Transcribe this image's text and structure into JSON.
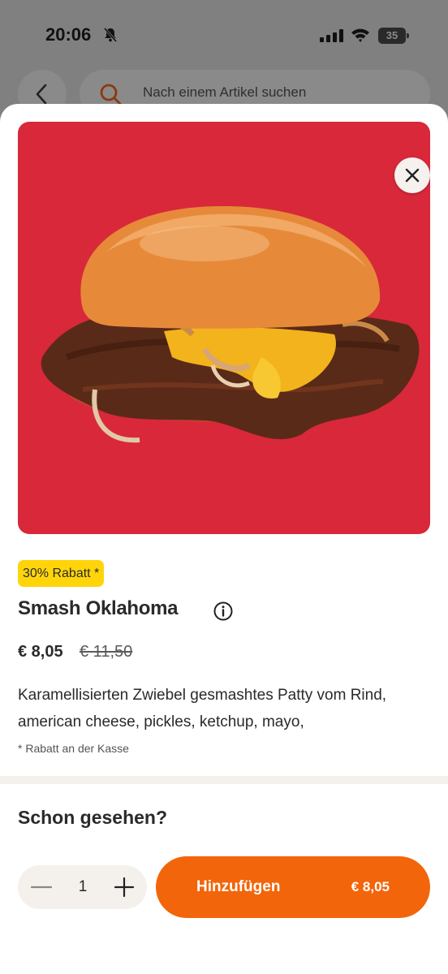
{
  "status_bar": {
    "time": "20:06",
    "battery": "35",
    "icons": [
      "bell-muted-icon",
      "signal-icon",
      "wifi-icon",
      "battery-icon"
    ]
  },
  "background": {
    "search": {
      "placeholder": "Nach einem Artikel suchen"
    }
  },
  "product": {
    "badge": "30% Rabatt *",
    "name": "Smash Oklahoma",
    "price": "€ 8,05",
    "old_price": "€ 11,50",
    "description": "Karamellisierten Zwiebel gesmashtes Patty vom Rind, american cheese, pickles, ketchup, mayo,",
    "note": "* Rabatt an der Kasse",
    "image_background": "#d9283a"
  },
  "suggestions": {
    "title": "Schon gesehen?"
  },
  "cart": {
    "quantity": "1",
    "add_label": "Hinzufügen",
    "add_price": "€ 8,05"
  },
  "colors": {
    "accent": "#f2650a",
    "badge": "#ffd50a",
    "hero": "#d9283a"
  }
}
